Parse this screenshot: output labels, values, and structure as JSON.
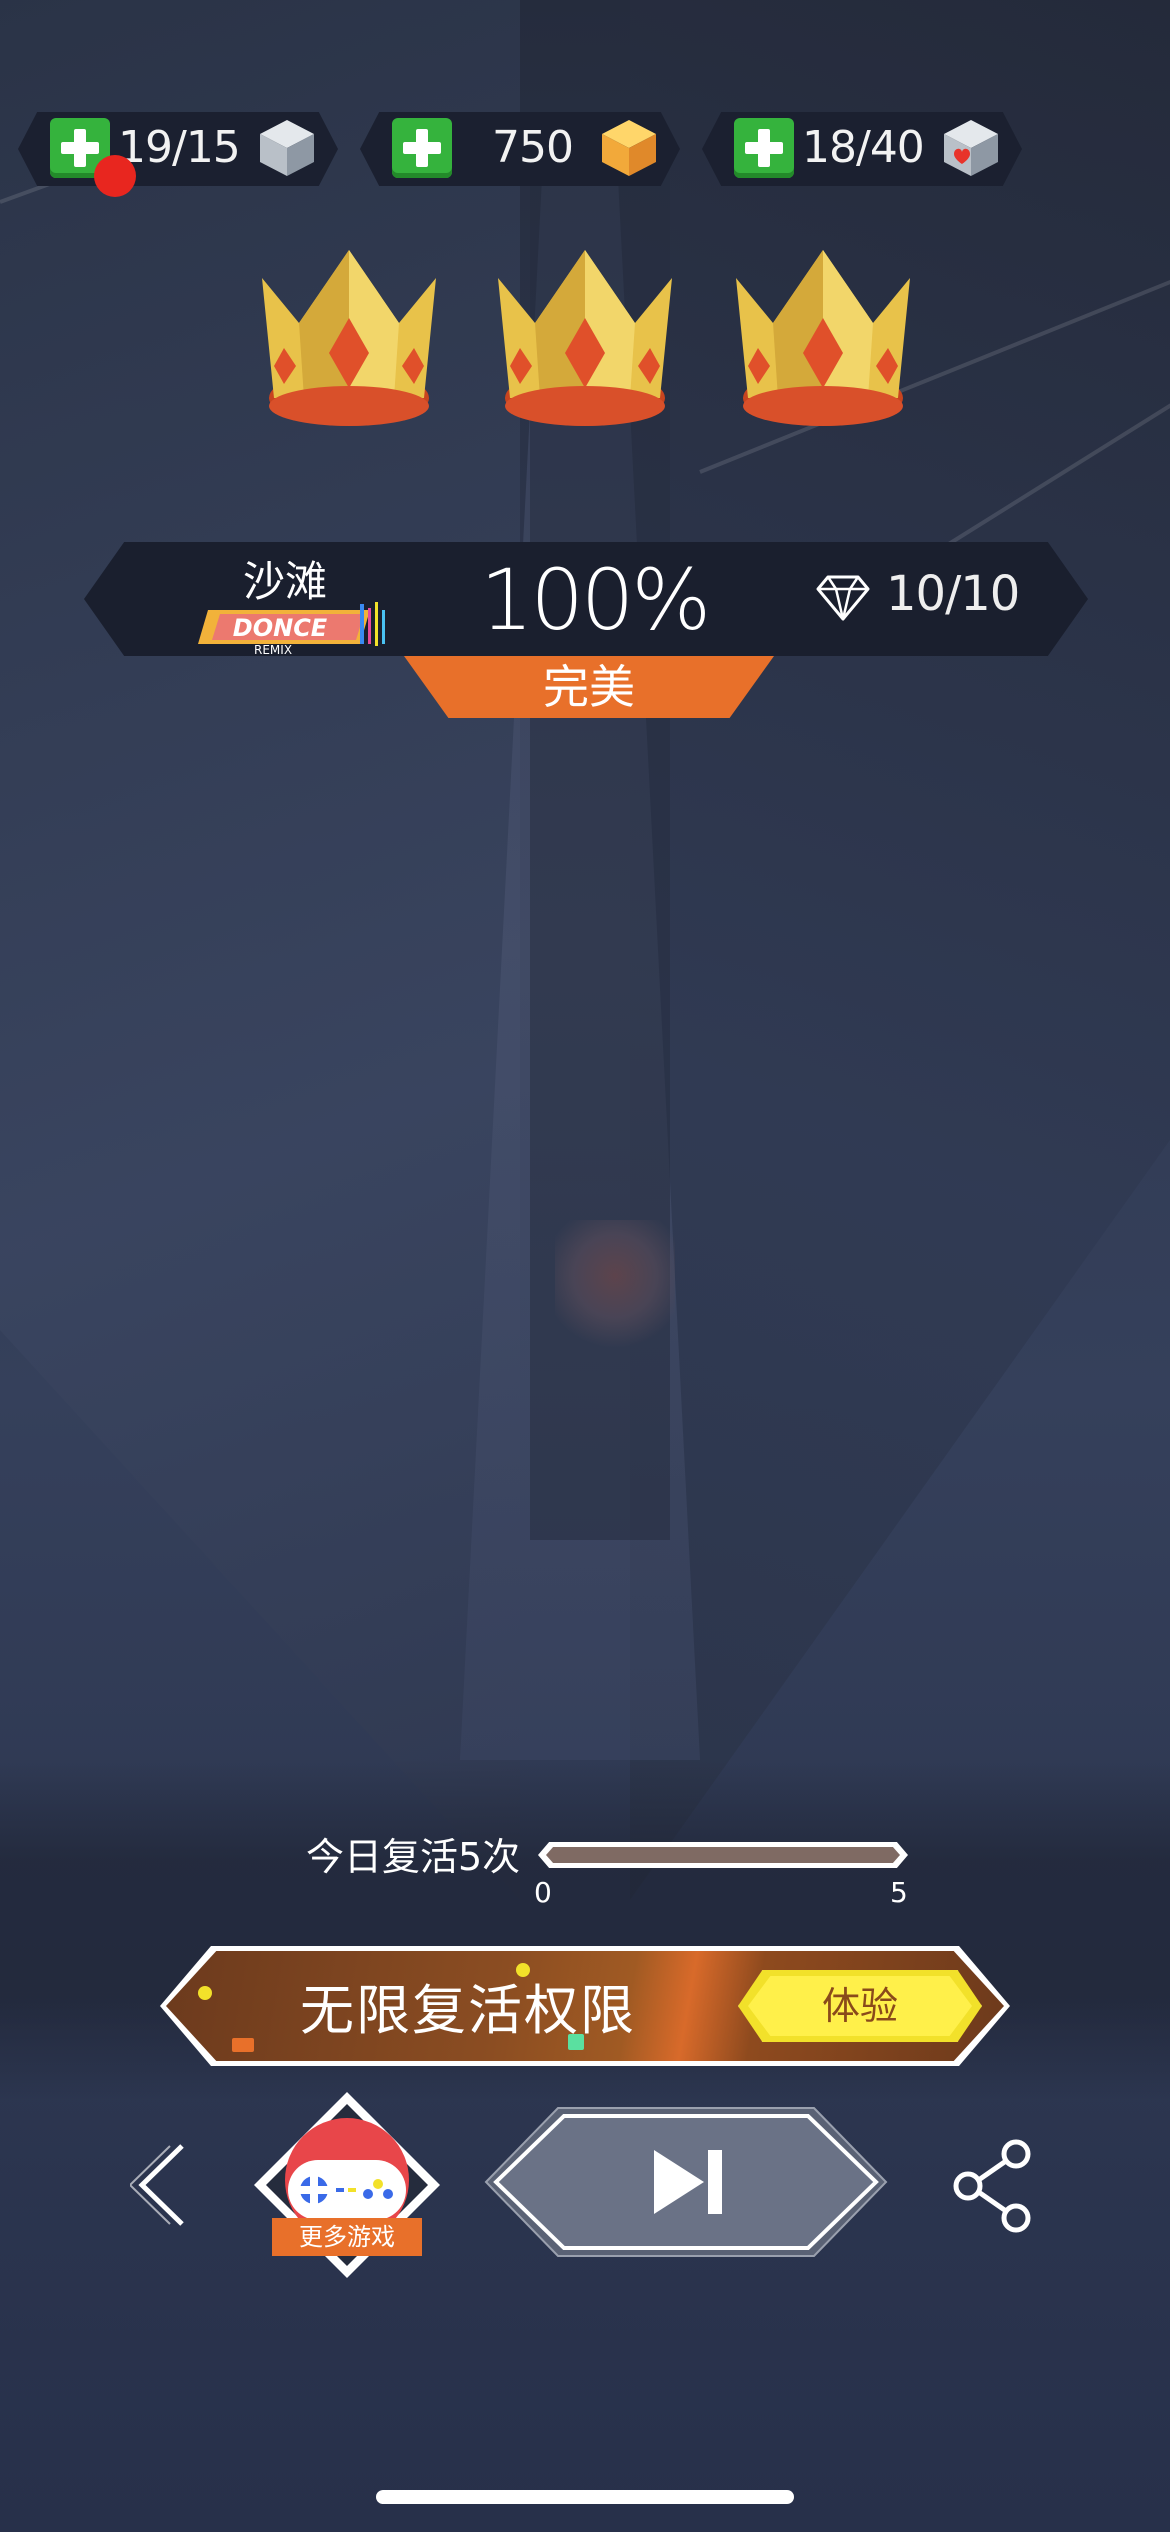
{
  "resources": {
    "energy": {
      "value": "19/15",
      "icon": "gray-cube-icon",
      "has_alert": true
    },
    "coins": {
      "value": "750",
      "icon": "gold-cube-icon"
    },
    "hearts": {
      "value": "18/40",
      "icon": "heart-cube-icon"
    }
  },
  "crowns": {
    "earned": 3,
    "total": 3
  },
  "result": {
    "song_name": "沙滩",
    "percent": "100%",
    "gems": "10/10",
    "grade": "完美"
  },
  "revive": {
    "label": "今日复活5次",
    "min": "0",
    "max": "5",
    "progress": 0
  },
  "promo": {
    "text": "无限复活权限",
    "button": "体验"
  },
  "controls": {
    "more_games": "更多游戏"
  },
  "colors": {
    "accent_orange": "#e8702a",
    "plus_green": "#35b33d",
    "alert_red": "#e8261f",
    "try_yellow": "#f2e12a"
  }
}
